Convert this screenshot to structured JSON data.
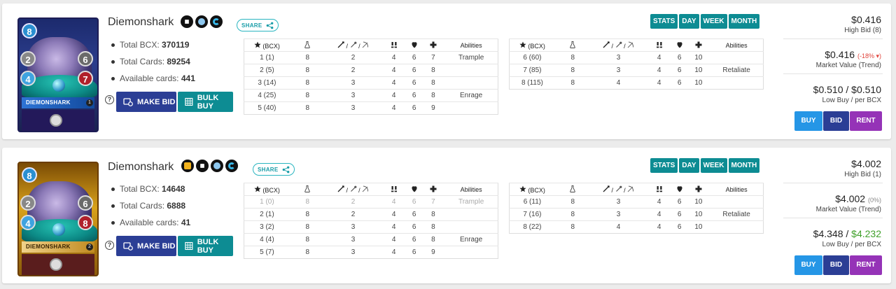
{
  "header_icons": {
    "bcx": "star-icon",
    "mana": "flask-icon",
    "attack": "sword-wand-bow-icon",
    "speed": "boots-icon",
    "health": "heart-icon",
    "armor": "shield-plus-icon"
  },
  "table_headers": {
    "bcx": "(BCX)",
    "atk_sep": "/ /",
    "abilities": "Abilities"
  },
  "tabs": [
    "STATS",
    "DAY",
    "WEEK",
    "MONTH"
  ],
  "buttons": {
    "make_bid": "MAKE BID",
    "bulk_buy": "BULK BUY",
    "share": "SHARE",
    "buy": "BUY",
    "bid": "BID",
    "rent": "RENT"
  },
  "labels": {
    "total_bcx": "Total BCX:",
    "total_cards": "Total Cards:",
    "available_cards": "Available cards:",
    "market_value": "Market Value (Trend)",
    "low_buy": "Low Buy / per BCX"
  },
  "cards": [
    {
      "name": "Diemonshark",
      "art_name": "DIEMONSHARK",
      "art_stats": {
        "mana": "8",
        "attack": "2",
        "speed": "4",
        "armor": "6",
        "health": "7",
        "level": "1"
      },
      "total_bcx": "370119",
      "total_cards": "89254",
      "available": "441",
      "high_bid": "$0.416",
      "high_bid_label": "High Bid (8)",
      "market_value": "$0.416",
      "trend": "(-18% ▾)",
      "low_buy_a": "$0.510",
      "low_buy_sep": " / ",
      "low_buy_b": "$0.510",
      "table1": [
        {
          "bcx": "1 (1)",
          "mana": "8",
          "atk": "2",
          "spd": "4",
          "hp": "6",
          "arm": "7",
          "ab": "Trample",
          "dim": false
        },
        {
          "bcx": "2 (5)",
          "mana": "8",
          "atk": "2",
          "spd": "4",
          "hp": "6",
          "arm": "8",
          "ab": "",
          "dim": false
        },
        {
          "bcx": "3 (14)",
          "mana": "8",
          "atk": "3",
          "spd": "4",
          "hp": "6",
          "arm": "8",
          "ab": "",
          "dim": false
        },
        {
          "bcx": "4 (25)",
          "mana": "8",
          "atk": "3",
          "spd": "4",
          "hp": "6",
          "arm": "8",
          "ab": "Enrage",
          "dim": false
        },
        {
          "bcx": "5 (40)",
          "mana": "8",
          "atk": "3",
          "spd": "4",
          "hp": "6",
          "arm": "9",
          "ab": "",
          "dim": false
        }
      ],
      "table2": [
        {
          "bcx": "6 (60)",
          "mana": "8",
          "atk": "3",
          "spd": "4",
          "hp": "6",
          "arm": "10",
          "ab": ""
        },
        {
          "bcx": "7 (85)",
          "mana": "8",
          "atk": "3",
          "spd": "4",
          "hp": "6",
          "arm": "10",
          "ab": "Retaliate"
        },
        {
          "bcx": "8 (115)",
          "mana": "8",
          "atk": "4",
          "spd": "4",
          "hp": "6",
          "arm": "10",
          "ab": ""
        }
      ]
    },
    {
      "name": "Diemonshark",
      "art_name": "DIEMONSHARK",
      "art_stats": {
        "mana": "8",
        "attack": "2",
        "speed": "4",
        "armor": "6",
        "health": "8",
        "level": "2"
      },
      "total_bcx": "14648",
      "total_cards": "6888",
      "available": "41",
      "high_bid": "$4.002",
      "high_bid_label": "High Bid (1)",
      "market_value": "$4.002",
      "trend": "(0%)",
      "low_buy_a": "$4.348",
      "low_buy_sep": " / ",
      "low_buy_b": "$4.232",
      "table1": [
        {
          "bcx": "1 (0)",
          "mana": "8",
          "atk": "2",
          "spd": "4",
          "hp": "6",
          "arm": "7",
          "ab": "Trample",
          "dim": true
        },
        {
          "bcx": "2 (1)",
          "mana": "8",
          "atk": "2",
          "spd": "4",
          "hp": "6",
          "arm": "8",
          "ab": "",
          "dim": false
        },
        {
          "bcx": "3 (2)",
          "mana": "8",
          "atk": "3",
          "spd": "4",
          "hp": "6",
          "arm": "8",
          "ab": "",
          "dim": false
        },
        {
          "bcx": "4 (4)",
          "mana": "8",
          "atk": "3",
          "spd": "4",
          "hp": "6",
          "arm": "8",
          "ab": "Enrage",
          "dim": false
        },
        {
          "bcx": "5 (7)",
          "mana": "8",
          "atk": "3",
          "spd": "4",
          "hp": "6",
          "arm": "9",
          "ab": "",
          "dim": false
        }
      ],
      "table2": [
        {
          "bcx": "6 (11)",
          "mana": "8",
          "atk": "3",
          "spd": "4",
          "hp": "6",
          "arm": "10",
          "ab": ""
        },
        {
          "bcx": "7 (16)",
          "mana": "8",
          "atk": "3",
          "spd": "4",
          "hp": "6",
          "arm": "10",
          "ab": "Retaliate"
        },
        {
          "bcx": "8 (22)",
          "mana": "8",
          "atk": "4",
          "spd": "4",
          "hp": "6",
          "arm": "10",
          "ab": ""
        }
      ]
    }
  ]
}
